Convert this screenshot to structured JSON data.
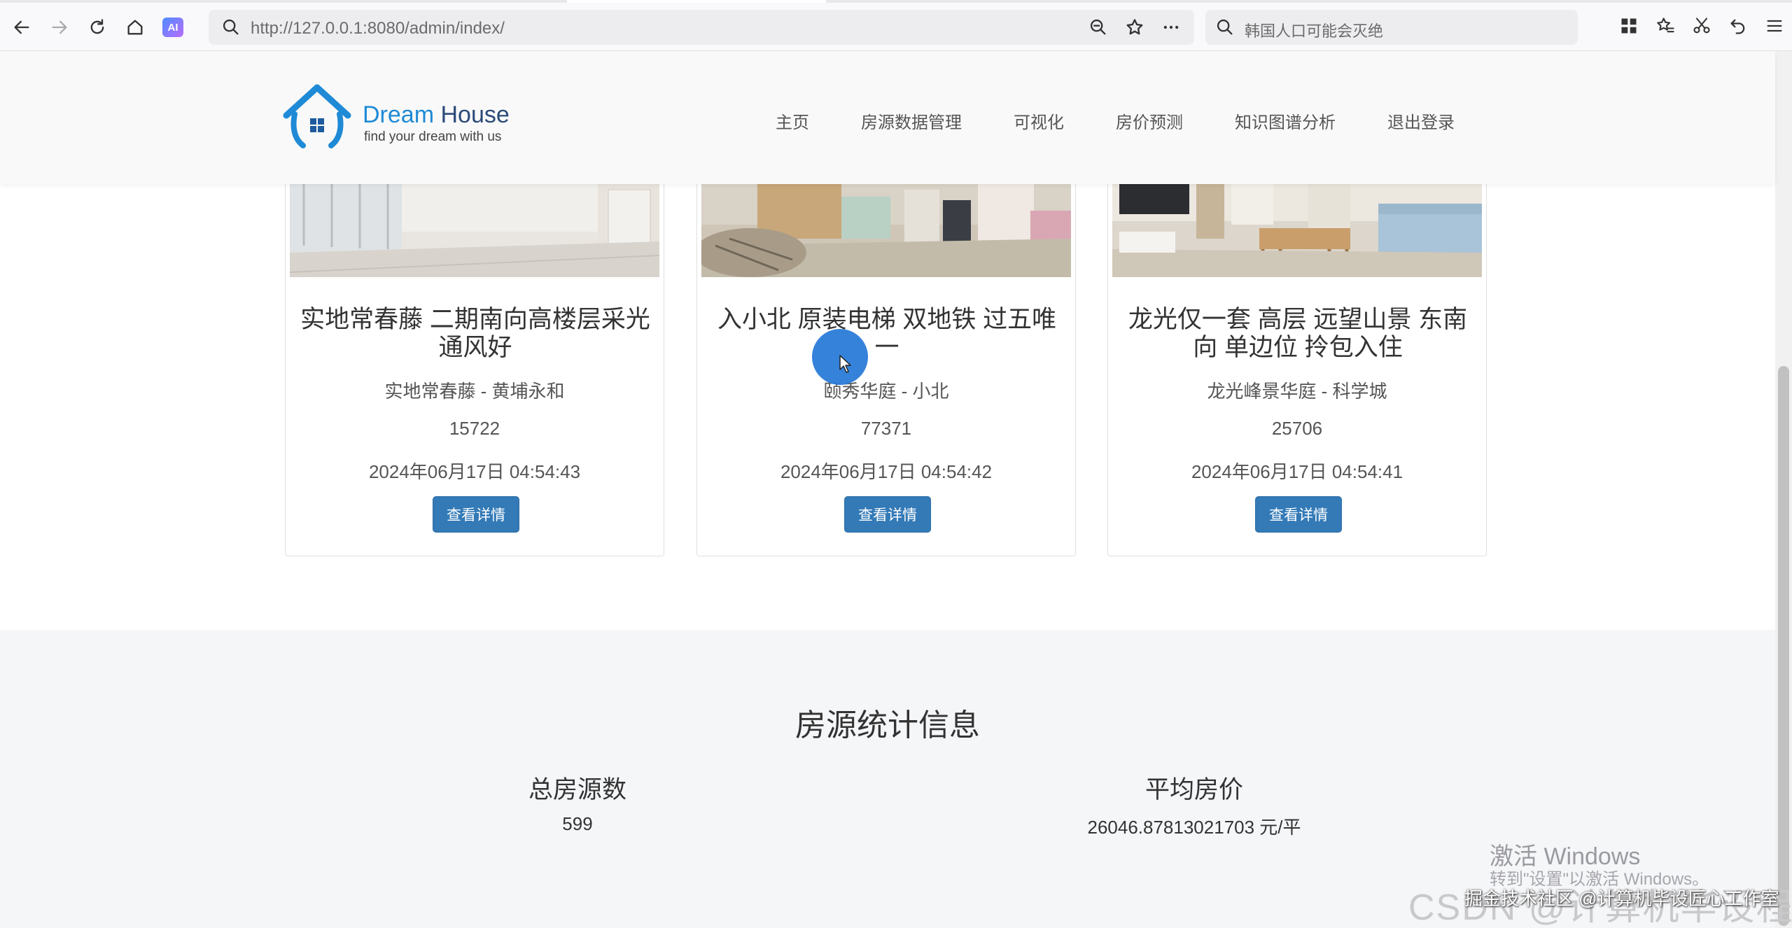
{
  "browser": {
    "url": "http://127.0.0.1:8080/admin/index/",
    "search_text": "韩国人口可能会灭绝",
    "ai_label": "AI"
  },
  "site": {
    "brand_part1": "Dream",
    "brand_part2": " House",
    "tagline": "find your dream with us",
    "nav": [
      "主页",
      "房源数据管理",
      "可视化",
      "房价预测",
      "知识图谱分析",
      "退出登录"
    ]
  },
  "cards": [
    {
      "title": "实地常春藤 二期南向高楼层采光通风好",
      "location": "实地常春藤 - 黄埔永和",
      "price": "15722",
      "time": "2024年06月17日 04:54:43",
      "button": "查看详情"
    },
    {
      "title": "入小北 原装电梯 双地铁 过五唯一",
      "location": "颐秀华庭 - 小北",
      "price": "77371",
      "time": "2024年06月17日 04:54:42",
      "button": "查看详情"
    },
    {
      "title": "龙光仅一套 高层 远望山景 东南向 单边位 拎包入住",
      "location": "龙光峰景华庭 - 科学城",
      "price": "25706",
      "time": "2024年06月17日 04:54:41",
      "button": "查看详情"
    }
  ],
  "stats": {
    "title": "房源统计信息",
    "total_label": "总房源数",
    "total_value": "599",
    "avg_label": "平均房价",
    "avg_value": "26046.87813021703 元/平"
  },
  "watermarks": {
    "windows_title": "激活 Windows",
    "windows_sub": "转到\"设置\"以激活 Windows。",
    "csdn": "CSDN @计算机毕设程序员",
    "juejin": "掘金技术社区 @计算机毕设匠心工作室"
  },
  "colors": {
    "brand_blue": "#1f8ad6",
    "button_blue": "#337ab7"
  }
}
